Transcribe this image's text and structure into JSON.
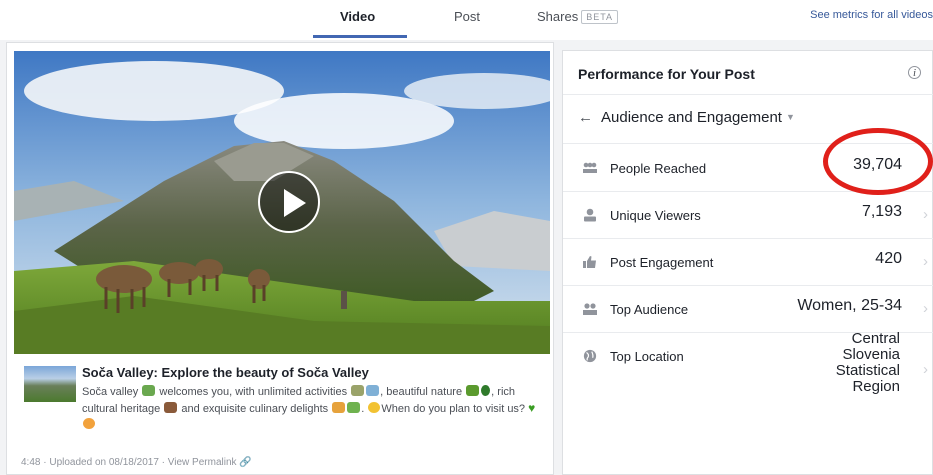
{
  "tabs": {
    "video": "Video",
    "post": "Post",
    "shares": "Shares",
    "shares_badge": "BETA",
    "metrics_link": "See metrics for all videos"
  },
  "post": {
    "title": "Soča Valley: Explore the beauty of Soča Valley",
    "desc_1": "Soča valley",
    "desc_2": "welcomes you, with unlimited activities",
    "desc_3": ", beautiful nature",
    "desc_4": ",",
    "desc_5": "rich cultural heritage",
    "desc_6": "and exquisite culinary delights",
    "desc_7": ".",
    "desc_8": "When do you plan to visit us?",
    "meta": "4:48 · Uploaded on 08/18/2017 · View Permalink"
  },
  "performance": {
    "title": "Performance for Your Post",
    "info_icon": "i",
    "section": "Audience and Engagement",
    "rows": [
      {
        "icon": "people-icon",
        "label": "People Reached",
        "value": "39,704"
      },
      {
        "icon": "person-icon",
        "label": "Unique Viewers",
        "value": "7,193"
      },
      {
        "icon": "thumbs-up-icon",
        "label": "Post Engagement",
        "value": "420"
      },
      {
        "icon": "audience-icon",
        "label": "Top Audience",
        "value": "Women, 25-34"
      },
      {
        "icon": "globe-icon",
        "label": "Top Location",
        "value": "Central Slovenia Statistical Region"
      }
    ],
    "location_lines": [
      "Central",
      "Slovenia",
      "Statistical",
      "Region"
    ]
  },
  "colors": {
    "accent": "#4267b2",
    "highlight": "#e0201a",
    "link": "#365899"
  }
}
